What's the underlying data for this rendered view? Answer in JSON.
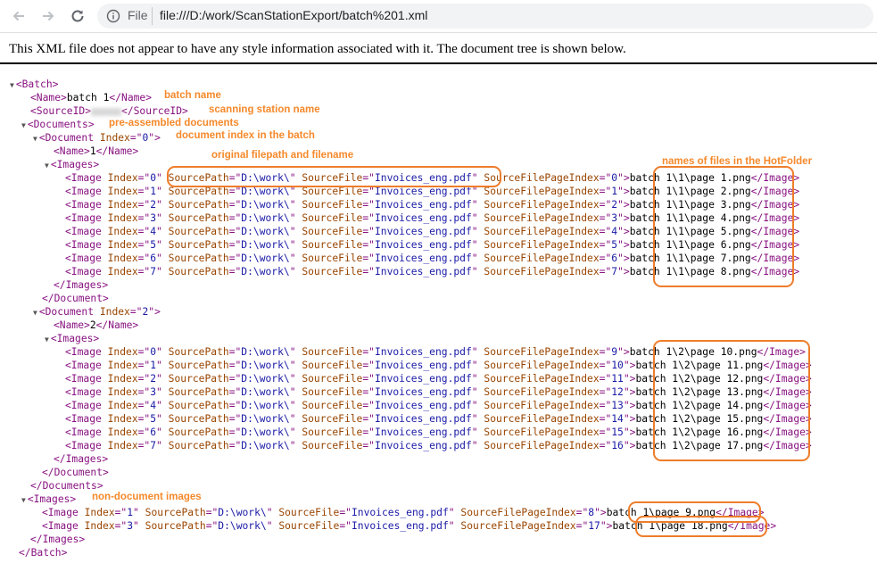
{
  "browser": {
    "back_icon": "arrow-left-icon",
    "forward_icon": "arrow-right-icon",
    "reload_icon": "reload-icon",
    "info_icon": "info-circle-icon",
    "scheme": "File",
    "url": "file:///D:/work/ScanStationExport/batch%201.xml"
  },
  "notice": "This XML file does not appear to have any style information associated with it. The document tree is shown below.",
  "xml": {
    "batch_tag": "Batch",
    "name_tag": "Name",
    "name_value": "batch 1",
    "sourceid_tag": "SourceID",
    "documents_tag": "Documents",
    "document_tag": "Document",
    "images_tag": "Images",
    "image_tag": "Image",
    "attr_index": "Index",
    "attr_source_path": "SourcePath",
    "attr_source_file": "SourceFile",
    "attr_page_index": "SourceFilePageIndex",
    "source_path": "D:\\work\\",
    "source_file": "Invoices_eng.pdf",
    "documents": [
      {
        "index": "0",
        "name": "1",
        "images": [
          {
            "index": "0",
            "page_index": "0",
            "file": "batch 1\\1\\page 1.png"
          },
          {
            "index": "1",
            "page_index": "1",
            "file": "batch 1\\1\\page 2.png"
          },
          {
            "index": "2",
            "page_index": "2",
            "file": "batch 1\\1\\page 3.png"
          },
          {
            "index": "3",
            "page_index": "3",
            "file": "batch 1\\1\\page 4.png"
          },
          {
            "index": "4",
            "page_index": "4",
            "file": "batch 1\\1\\page 5.png"
          },
          {
            "index": "5",
            "page_index": "5",
            "file": "batch 1\\1\\page 6.png"
          },
          {
            "index": "6",
            "page_index": "6",
            "file": "batch 1\\1\\page 7.png"
          },
          {
            "index": "7",
            "page_index": "7",
            "file": "batch 1\\1\\page 8.png"
          }
        ]
      },
      {
        "index": "2",
        "name": "2",
        "images": [
          {
            "index": "0",
            "page_index": "9",
            "file": "batch 1\\2\\page 10.png"
          },
          {
            "index": "1",
            "page_index": "10",
            "file": "batch 1\\2\\page 11.png"
          },
          {
            "index": "2",
            "page_index": "11",
            "file": "batch 1\\2\\page 12.png"
          },
          {
            "index": "3",
            "page_index": "12",
            "file": "batch 1\\2\\page 13.png"
          },
          {
            "index": "4",
            "page_index": "13",
            "file": "batch 1\\2\\page 14.png"
          },
          {
            "index": "5",
            "page_index": "14",
            "file": "batch 1\\2\\page 15.png"
          },
          {
            "index": "6",
            "page_index": "15",
            "file": "batch 1\\2\\page 16.png"
          },
          {
            "index": "7",
            "page_index": "16",
            "file": "batch 1\\2\\page 17.png"
          }
        ]
      }
    ],
    "loose_images": [
      {
        "index": "1",
        "page_index": "8",
        "file": "batch 1\\page 9.png"
      },
      {
        "index": "3",
        "page_index": "17",
        "file": "batch 1\\page 18.png"
      }
    ]
  },
  "annotations": {
    "batch_name": "batch name",
    "scanning_station": "scanning station name",
    "pre_assembled": "pre-assembled documents",
    "document_index": "document index in the batch",
    "original_filepath": "original filepath and filename",
    "hotfolder_names": "names of files in the HotFolder",
    "non_document": "non-document images"
  },
  "colors": {
    "tag": "#881280",
    "attr_name": "#994500",
    "attr_value": "#1a1aa6",
    "annotation": "#f5892b"
  }
}
